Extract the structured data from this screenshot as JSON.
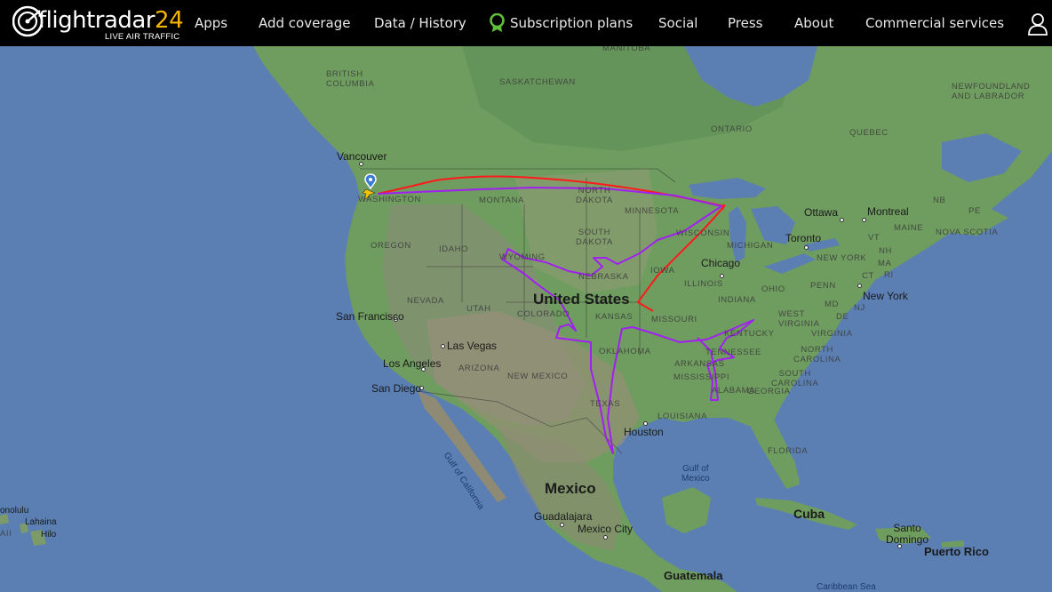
{
  "header": {
    "logo_text": "flightradar",
    "logo_number": "24",
    "tagline": "LIVE AIR TRAFFIC",
    "nav": [
      {
        "label": "Apps"
      },
      {
        "label": "Add coverage"
      },
      {
        "label": "Data / History"
      },
      {
        "label": "Subscription plans"
      },
      {
        "label": "Social"
      },
      {
        "label": "Press"
      },
      {
        "label": "About"
      },
      {
        "label": "Commercial services"
      }
    ],
    "user_icon": "user-icon",
    "badge_icon": "award-badge-icon"
  },
  "map": {
    "regions": {
      "british_columbia": "BRITISH COLUMBIA",
      "manitoba": "MANITOBA",
      "saskatchewan": "SASKATCHEWAN",
      "ontario": "ONTARIO",
      "quebec": "QUEBEC",
      "newfoundland": "NEWFOUNDLAND AND LABRADOR",
      "washington": "WASHINGTON",
      "montana": "MONTANA",
      "north_dakota": "NORTH DAKOTA",
      "minnesota": "MINNESOTA",
      "south_dakota": "SOUTH DAKOTA",
      "wisconsin": "WISCONSIN",
      "michigan": "MICHIGAN",
      "oregon": "OREGON",
      "idaho": "IDAHO",
      "wyoming": "WYOMING",
      "nebraska": "NEBRASKA",
      "iowa": "IOWA",
      "nevada": "NEVADA",
      "utah": "UTAH",
      "colorado": "COLORADO",
      "kansas": "KANSAS",
      "missouri": "MISSOURI",
      "illinois": "ILLINOIS",
      "indiana": "INDIANA",
      "ohio": "OHIO",
      "penn": "PENN",
      "west_virginia": "WEST VIRGINIA",
      "virginia": "VIRGINIA",
      "kentucky": "KENTUCKY",
      "tennessee": "TENNESSEE",
      "north_carolina": "NORTH CAROLINA",
      "south_carolina": "SOUTH CAROLINA",
      "arizona": "ARIZONA",
      "new_mexico": "NEW MEXICO",
      "oklahoma": "OKLAHOMA",
      "arkansas": "ARKANSAS",
      "texas": "TEXAS",
      "mississippi": "MISSISSIPPI",
      "alabama": "ALABAMA",
      "georgia": "GEORGIA",
      "louisiana": "LOUISIANA",
      "florida": "FLORIDA",
      "new_york_state": "NEW YORK",
      "vt": "VT",
      "nh": "NH",
      "ma": "MA",
      "ct": "CT",
      "ri": "RI",
      "nj": "NJ",
      "md": "MD",
      "de": "DE",
      "maine": "MAINE",
      "nb": "NB",
      "pe": "PE",
      "nova_scotia": "NOVA SCOTIA"
    },
    "cities": {
      "vancouver": "Vancouver",
      "ottawa": "Ottawa",
      "montreal": "Montreal",
      "toronto": "Toronto",
      "chicago": "Chicago",
      "new_york": "New York",
      "san_francisco": "San Francisco",
      "las_vegas": "Las Vegas",
      "los_angeles": "Los Angeles",
      "san_diego": "San Diego",
      "houston": "Houston",
      "guadalajara": "Guadalajara",
      "mexico_city": "Mexico City",
      "guatemala": "Guatemala",
      "santo_domingo": "Santo\nDomingo",
      "honolulu": "onolulu",
      "lahaina": "Lahaina",
      "hilo": "Hilo",
      "hawaii": "AII"
    },
    "countries": {
      "united_states": "United States",
      "mexico": "Mexico",
      "cuba": "Cuba",
      "puerto_rico": "Puerto Rico"
    },
    "water": {
      "gulf_of_mexico": "Gulf of\nMexico",
      "gulf_of_california": "Gulf of California",
      "caribbean_sea": "Caribbean Sea"
    },
    "colors": {
      "ocean": "#5b7fb3",
      "track_red": "#ff1a1a",
      "track_purple": "#a020f0",
      "aircraft": "#f5c400"
    }
  }
}
